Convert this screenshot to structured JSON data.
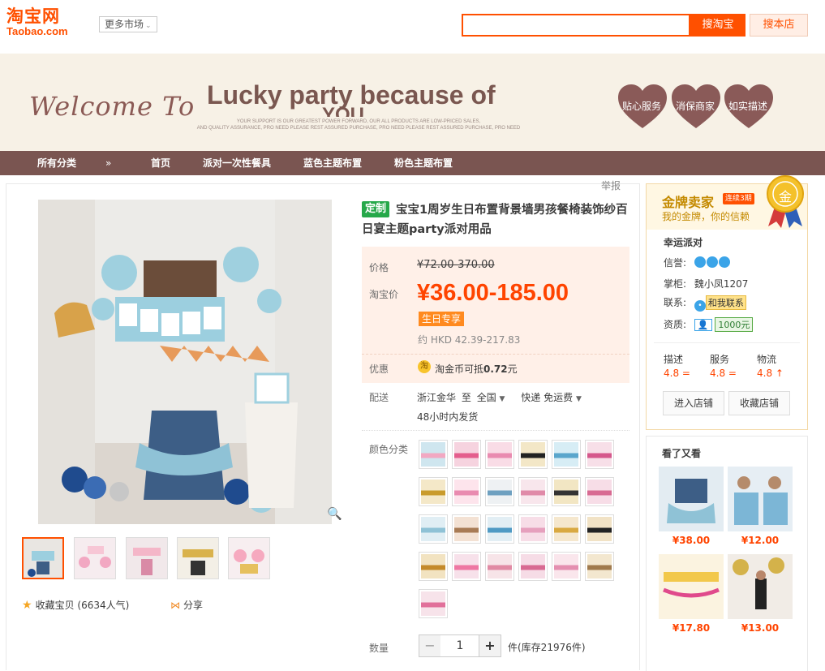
{
  "header": {
    "logo_cn": "淘宝网",
    "logo_en": "Taobao.com",
    "market_label": "更多市场",
    "search_placeholder": "",
    "search_taobao": "搜淘宝",
    "search_shop": "搜本店"
  },
  "banner": {
    "welcome": "Welcome To",
    "headline": "Lucky party because of",
    "headline_cut": "YOU",
    "small_line1": "YOUR SUPPORT IS OUR GREATEST POWER FORWARD, OUR ALL PRODUCTS ARE LOW-PRICED SALES,",
    "small_line2": "AND QUALITY ASSURANCE, PRO NEED PLEASE REST ASSURED PURCHASE, PRO NEED PLEASE REST ASSURED PURCHASE, PRO NEED",
    "hearts": [
      "贴心服务",
      "消保商家",
      "如实描述"
    ],
    "heart_color": "#8a5a58"
  },
  "nav": {
    "items": [
      "所有分类",
      "»",
      "首页",
      "派对一次性餐具",
      "蓝色主题布置",
      "粉色主题布置"
    ]
  },
  "report_label": "举报",
  "product": {
    "tag": "定制",
    "title": "宝宝1周岁生日布置背景墙男孩餐椅装饰纱百日宴主题party派对用品",
    "price_label": "价格",
    "original_price": "¥72.00-370.00",
    "tb_price_label": "淘宝价",
    "tb_price": "¥36.00-185.00",
    "promo": "生日专享",
    "hkd": "约 HKD 42.39-217.83",
    "discount_label": "优惠",
    "coin_icon": "淘",
    "discount_text": "淘金币可抵",
    "discount_amount": "0.72",
    "discount_unit": "元",
    "ship_label": "配送",
    "ship_from": "浙江金华",
    "ship_to_word": "至",
    "ship_to": "全国",
    "ship_method": "快递 免运费",
    "ship_time": "48小时内发货",
    "color_label": "颜色分类",
    "qty_label": "数量",
    "qty_value": "1",
    "qty_minus": "−",
    "qty_plus": "+",
    "stock": "件(库存21976件)",
    "fav_label": "收藏宝贝",
    "fav_count": "(6634人气)",
    "share_label": "分享"
  },
  "shop": {
    "gold_title": "金牌卖家",
    "continuous": "连续3期",
    "gold_sub": "我的金牌，你的信赖",
    "medal_text": "金",
    "name": "幸运派对",
    "credit_label": "信誉:",
    "keeper_label": "掌柜:",
    "keeper": "魏小凤1207",
    "contact_label": "联系:",
    "contact_btn": "和我联系",
    "qual_label": "资质:",
    "qual_amount": "1000元",
    "scores": [
      {
        "label": "描述",
        "value": "4.8",
        "trend": "="
      },
      {
        "label": "服务",
        "value": "4.8",
        "trend": "="
      },
      {
        "label": "物流",
        "value": "4.8",
        "trend": "↑"
      }
    ],
    "enter_shop": "进入店铺",
    "fav_shop": "收藏店铺"
  },
  "seen": {
    "title": "看了又看",
    "items": [
      {
        "price": "¥38.00"
      },
      {
        "price": "¥12.00"
      },
      {
        "price": "¥17.80"
      },
      {
        "price": "¥13.00"
      }
    ]
  }
}
